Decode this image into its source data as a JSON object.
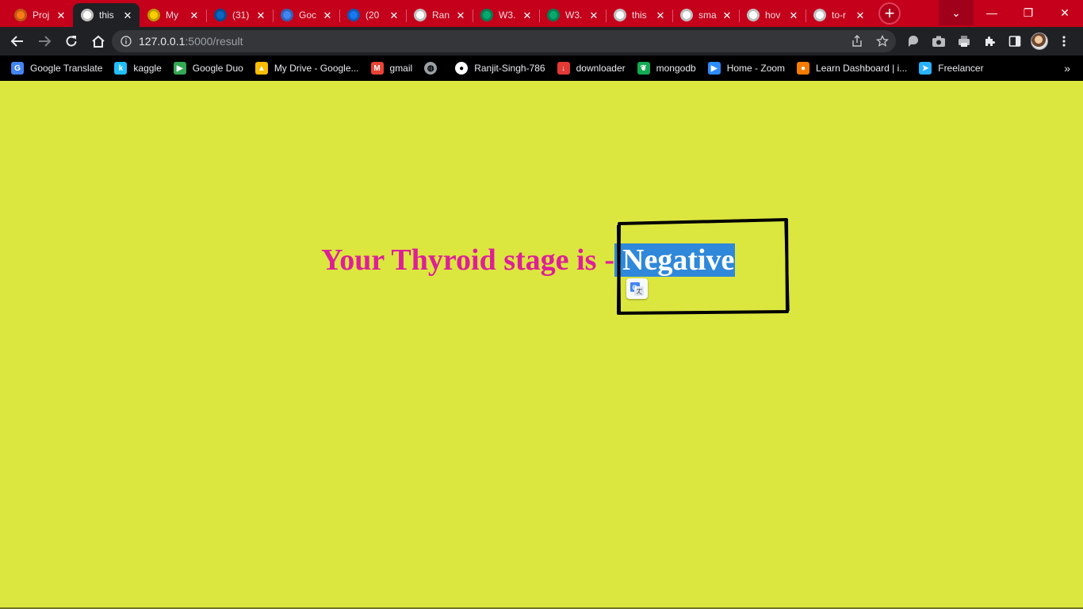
{
  "browser": {
    "tabs": [
      {
        "title": "Proj",
        "icon": "firefox-style-icon",
        "color": "#ff7a18",
        "active": false
      },
      {
        "title": "this",
        "icon": "globe-icon",
        "color": "#ffffff",
        "active": true
      },
      {
        "title": "My",
        "icon": "google-drive-icon",
        "color": "#ffcc00",
        "active": false
      },
      {
        "title": "(31)",
        "icon": "linkedin-icon",
        "color": "#0a66c2",
        "active": false
      },
      {
        "title": "Goc",
        "icon": "google-translate-icon",
        "color": "#4285f4",
        "active": false
      },
      {
        "title": "(20",
        "icon": "facebook-icon",
        "color": "#1877f2",
        "active": false
      },
      {
        "title": "Ran",
        "icon": "github-icon",
        "color": "#ffffff",
        "active": false
      },
      {
        "title": "W3.",
        "icon": "w3schools-icon",
        "color": "#04aa6d",
        "active": false
      },
      {
        "title": "W3.",
        "icon": "w3schools-icon",
        "color": "#04aa6d",
        "active": false
      },
      {
        "title": "this",
        "icon": "globe-icon",
        "color": "#ffffff",
        "active": false
      },
      {
        "title": "sma",
        "icon": "globe-icon",
        "color": "#ffffff",
        "active": false
      },
      {
        "title": "hov",
        "icon": "google-icon",
        "color": "#ffffff",
        "active": false
      },
      {
        "title": "to-r",
        "icon": "cube-icon",
        "color": "#ffffff",
        "active": false
      }
    ],
    "close_glyph": "✕",
    "new_tab_glyph": "+",
    "window_controls": {
      "dropdown": "⌄",
      "minimize": "—",
      "restore": "❐",
      "close": "✕"
    },
    "address": {
      "host": "127.0.0.1",
      "path": ":5000/result"
    },
    "bookmarks": [
      {
        "label": "Google Translate",
        "icon": "google-translate-icon",
        "color": "#4285f4",
        "glyph": "G"
      },
      {
        "label": "kaggle",
        "icon": "kaggle-icon",
        "color": "#20beff",
        "glyph": "k"
      },
      {
        "label": "Google Duo",
        "icon": "google-duo-icon",
        "color": "#34a853",
        "glyph": "▶"
      },
      {
        "label": "My Drive - Google...",
        "icon": "google-drive-icon",
        "color": "#fbbc04",
        "glyph": "▲"
      },
      {
        "label": "gmail",
        "icon": "gmail-icon",
        "color": "#ea4335",
        "glyph": "M"
      },
      {
        "label": "",
        "icon": "globe-icon",
        "color": "#9aa0a6",
        "glyph": "◍"
      },
      {
        "label": "Ranjit-Singh-786",
        "icon": "github-icon",
        "color": "#ffffff",
        "glyph": "●"
      },
      {
        "label": "downloader",
        "icon": "download-icon",
        "color": "#e53935",
        "glyph": "↓"
      },
      {
        "label": "mongodb",
        "icon": "mongodb-leaf-icon",
        "color": "#13aa52",
        "glyph": "❦"
      },
      {
        "label": "Home - Zoom",
        "icon": "zoom-icon",
        "color": "#2d8cff",
        "glyph": "▶"
      },
      {
        "label": "Learn Dashboard | i...",
        "icon": "learn-dashboard-icon",
        "color": "#f57c00",
        "glyph": "●"
      },
      {
        "label": "Freelancer",
        "icon": "freelancer-icon",
        "color": "#29b2fe",
        "glyph": "➤"
      }
    ],
    "bookmarks_more": "»"
  },
  "page": {
    "background": "#dbe63f",
    "heading_label": "Your Thyroid stage is",
    "separator": "-",
    "result": "Negative",
    "label_color": "#de1f98",
    "selection_color": "#2f88d9"
  }
}
